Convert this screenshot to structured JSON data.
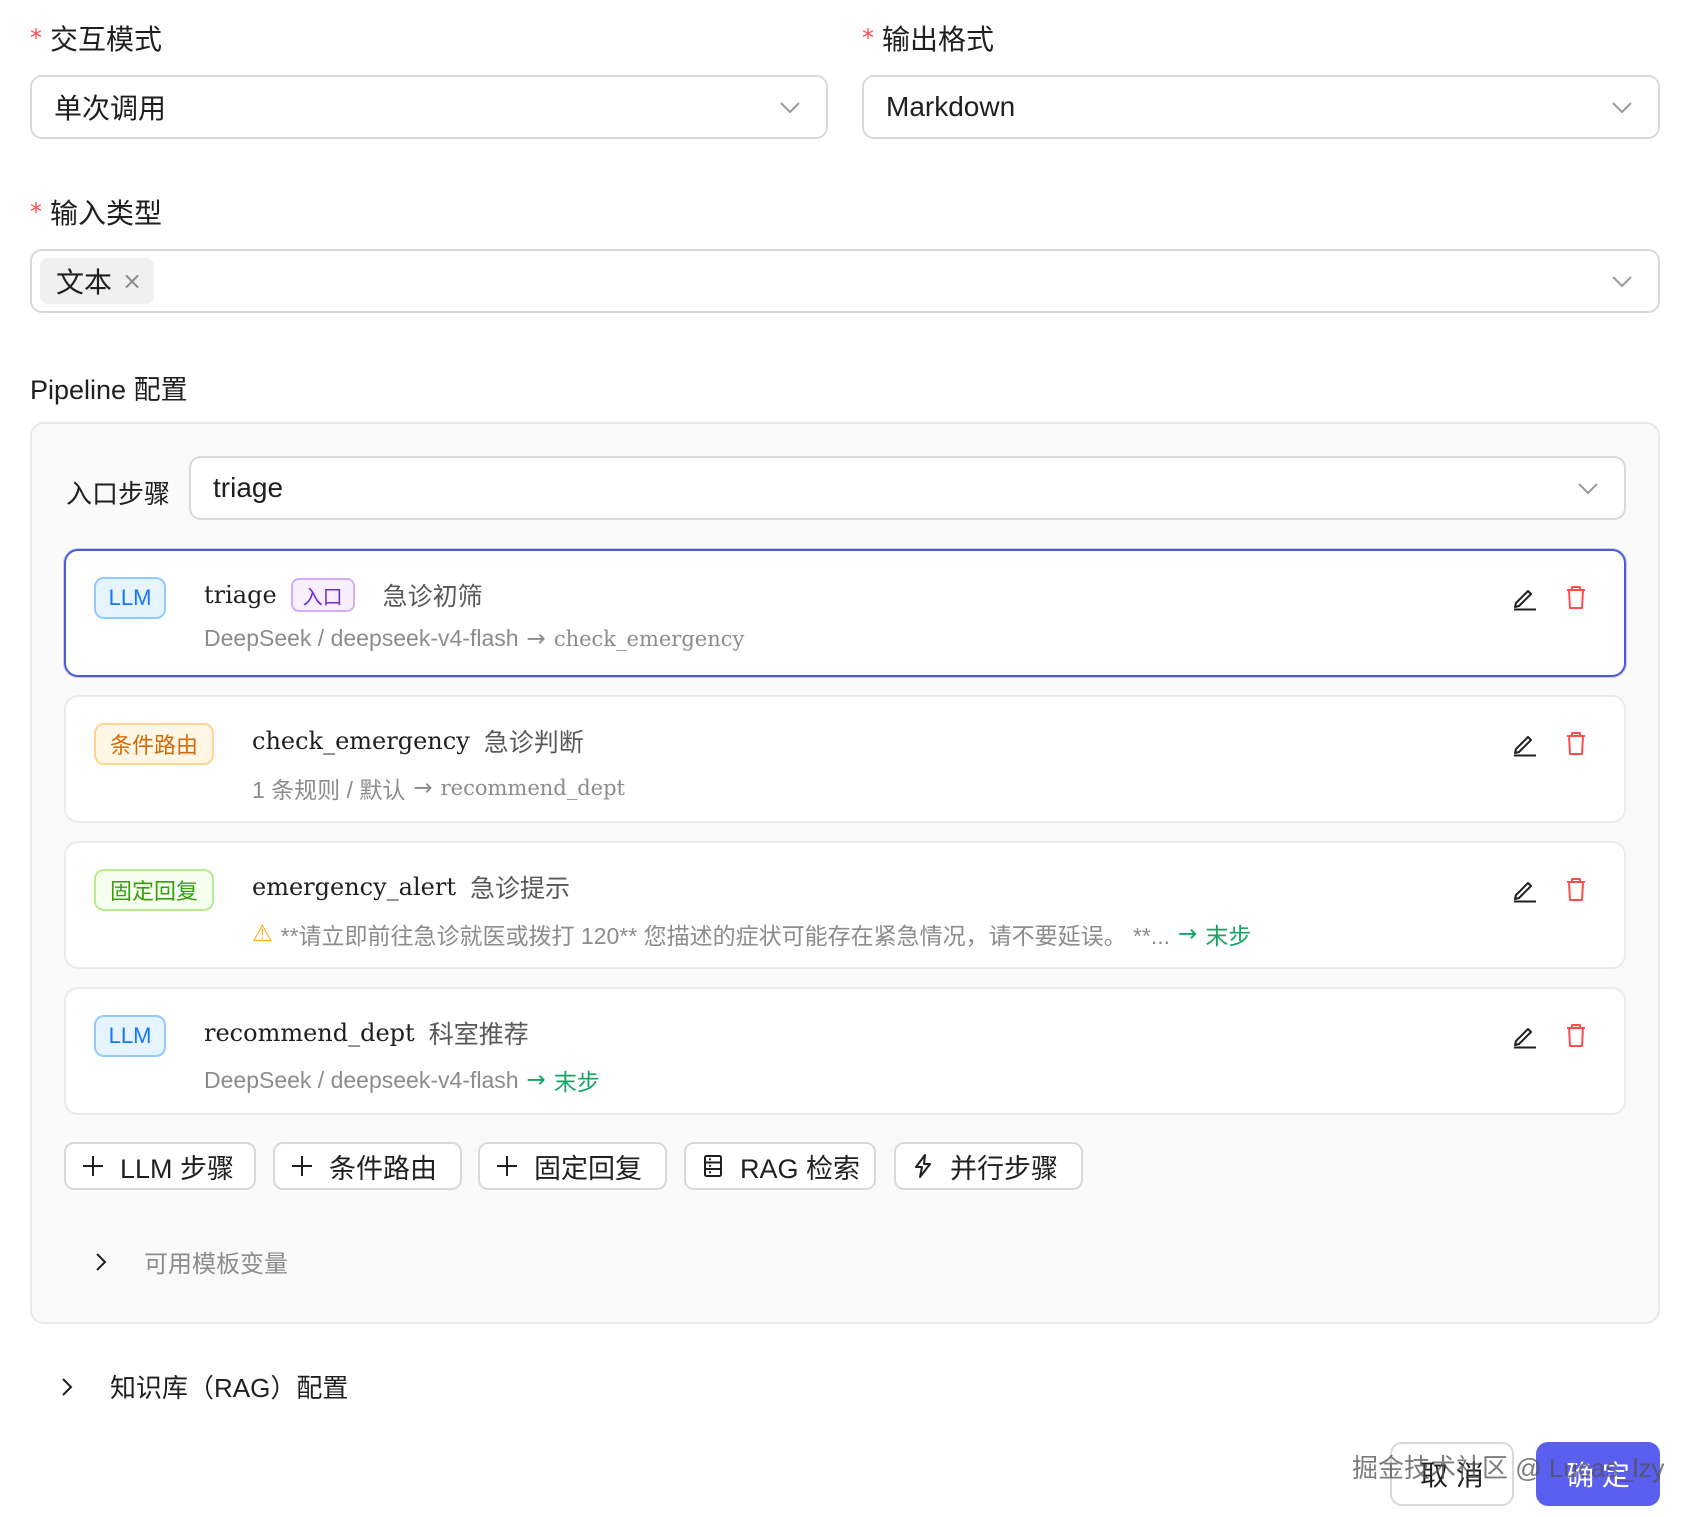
{
  "form": {
    "interaction_mode": {
      "required_mark": "*",
      "label": "交互模式",
      "value": "单次调用"
    },
    "output_format": {
      "required_mark": "*",
      "label": "输出格式",
      "value": "Markdown"
    },
    "input_type": {
      "required_mark": "*",
      "label": "输入类型",
      "tags": [
        "文本"
      ],
      "tag_close": "×"
    }
  },
  "pipeline": {
    "title": "Pipeline 配置",
    "entry_step_label": "入口步骤",
    "entry_step_value": "triage",
    "steps": [
      {
        "badge": "LLM",
        "name": "triage",
        "entry_badge": "入口",
        "title": "急诊初筛",
        "detail": "DeepSeek / deepseek-v4-flash",
        "arrow": "→",
        "next": "check_emergency"
      },
      {
        "badge": "条件路由",
        "name": "check_emergency",
        "title": "急诊判断",
        "detail": "1 条规则 / 默认",
        "arrow": "→",
        "next": "recommend_dept"
      },
      {
        "badge": "固定回复",
        "name": "emergency_alert",
        "title": "急诊提示",
        "warn_icon": "⚠",
        "detail": "**请立即前往急诊就医或拨打 120** 您描述的症状可能存在紧急情况，请不要延误。 **...",
        "arrow": "→",
        "next": "末步"
      },
      {
        "badge": "LLM",
        "name": "recommend_dept",
        "title": "科室推荐",
        "detail": "DeepSeek / deepseek-v4-flash",
        "arrow": "→",
        "next": "末步"
      }
    ],
    "add_buttons": [
      {
        "icon": "+",
        "label": "LLM 步骤"
      },
      {
        "icon": "+",
        "label": "条件路由"
      },
      {
        "icon": "+",
        "label": "固定回复"
      },
      {
        "icon": "database-icon",
        "label": "RAG 检索"
      },
      {
        "icon": "lightning-icon",
        "label": "并行步骤"
      }
    ],
    "template_vars_label": "可用模板变量"
  },
  "rag_section_label": "知识库（RAG）配置",
  "footer": {
    "cancel": "取 消",
    "ok": "确 定"
  },
  "watermark": "掘金技术社区 @ Lucas_lzy",
  "colors": {
    "primary": "#5b5ff0",
    "active_border": "#4f5bd5",
    "required": "#ff4d4f",
    "next_step_green": "#13a662",
    "delete_red": "#ff4d4f"
  }
}
